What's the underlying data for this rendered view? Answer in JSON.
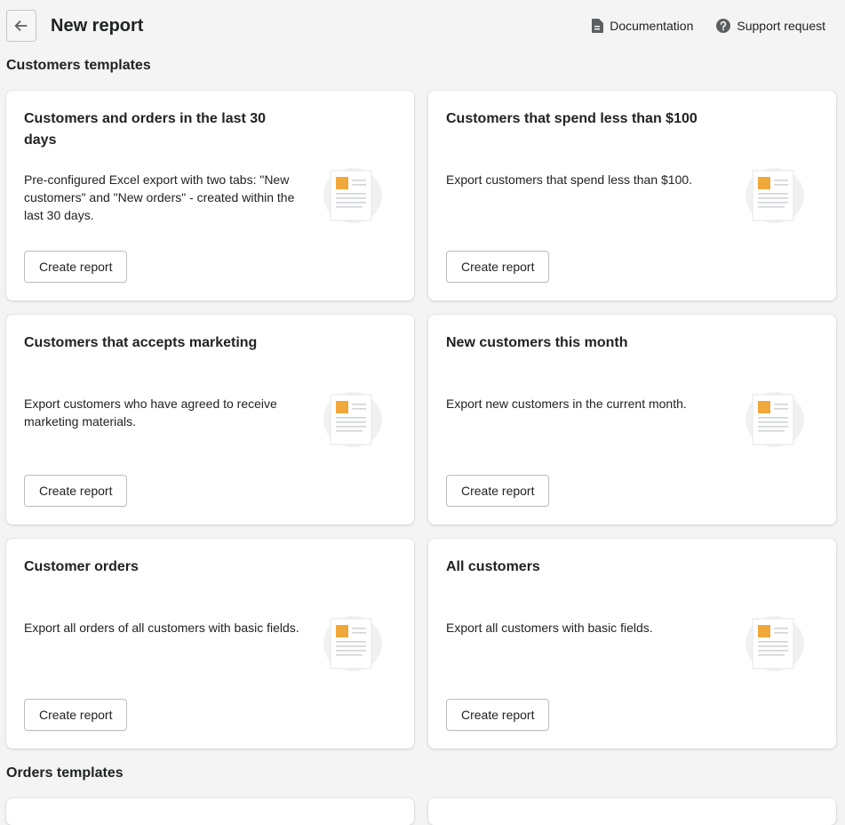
{
  "header": {
    "title": "New report",
    "documentation_label": "Documentation",
    "support_label": "Support request"
  },
  "sections": {
    "customers_title": "Customers templates",
    "orders_title": "Orders templates"
  },
  "cards": [
    {
      "title": "Customers and orders in the last 30 days",
      "description": "Pre-configured Excel export with two tabs: \"New customers\" and \"New orders\" - created within the last 30 days.",
      "button": "Create report"
    },
    {
      "title": "Customers that spend less than $100",
      "description": "Export customers that spend less than $100.",
      "button": "Create report"
    },
    {
      "title": "Customers that accepts marketing",
      "description": "Export customers who have agreed to receive marketing materials.",
      "button": "Create report"
    },
    {
      "title": "New customers this month",
      "description": "Export new customers in the current month.",
      "button": "Create report"
    },
    {
      "title": "Customer orders",
      "description": "Export all orders of all customers with basic fields.",
      "button": "Create report"
    },
    {
      "title": "All customers",
      "description": "Export all customers with basic fields.",
      "button": "Create report"
    }
  ],
  "icons": {
    "back": "arrow-left-icon",
    "documentation": "document-icon",
    "support": "question-circle-icon",
    "card": "report-illustration-icon"
  },
  "colors": {
    "background": "#f4f4f4",
    "card": "#ffffff",
    "text": "#202223",
    "illustration_accent": "#f0a83a"
  }
}
